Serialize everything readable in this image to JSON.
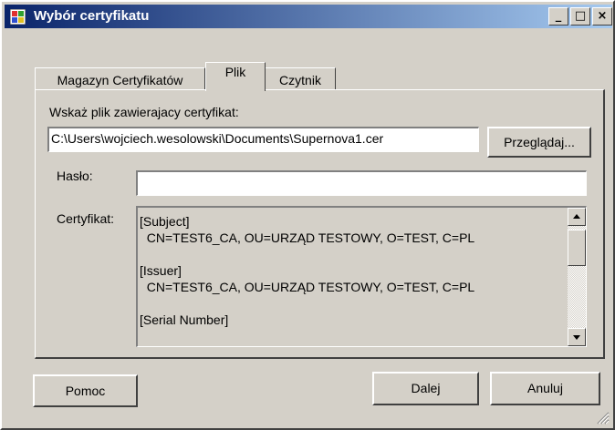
{
  "window": {
    "title": "Wybór certyfikatu"
  },
  "titlebar_buttons": {
    "minimize": "_",
    "maximize": "□",
    "close": "×"
  },
  "tabs": [
    {
      "label": "Magazyn Certyfikatów",
      "active": false
    },
    {
      "label": "Plik",
      "active": true
    },
    {
      "label": "Czytnik",
      "active": false
    }
  ],
  "file_section": {
    "prompt": "Wskaż plik zawierajacy certyfikat:",
    "path_value": "C:\\Users\\wojciech.wesolowski\\Documents\\Supernova1.cer",
    "browse_label": "Przeglądaj..."
  },
  "password": {
    "label": "Hasło:",
    "value": ""
  },
  "certificate": {
    "label": "Certyfikat:",
    "subject_header": "[Subject]",
    "subject_value": "  CN=TEST6_CA, OU=URZĄD TESTOWY, O=TEST, C=PL",
    "issuer_header": "[Issuer]",
    "issuer_value": "  CN=TEST6_CA, OU=URZĄD TESTOWY, O=TEST, C=PL",
    "serial_header": "[Serial Number]"
  },
  "footer": {
    "help_label": "Pomoc",
    "next_label": "Dalej",
    "cancel_label": "Anuluj"
  },
  "colors": {
    "title_start": "#0a246a",
    "title_end": "#a6caf0",
    "face": "#d4d0c8"
  }
}
